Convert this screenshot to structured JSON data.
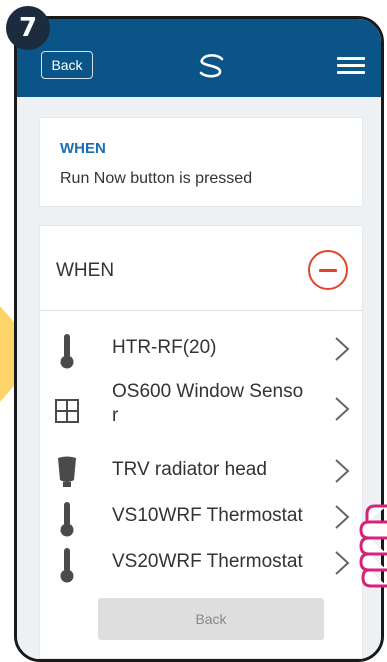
{
  "step": "7",
  "header": {
    "back_label": "Back",
    "logo_icon": "salus-logo-icon",
    "menu_icon": "hamburger-menu-icon"
  },
  "trigger_card": {
    "heading": "WHEN",
    "description": "Run Now button is pressed"
  },
  "when_card": {
    "title": "WHEN",
    "remove_icon": "remove-minus-icon",
    "devices": [
      {
        "label": "HTR-RF(20)",
        "icon": "thermometer-icon"
      },
      {
        "label": "OS600 Window Senso\nr",
        "icon": "window-icon"
      },
      {
        "label": "TRV radiator head",
        "icon": "trv-head-icon"
      },
      {
        "label": "VS10WRF Thermostat",
        "icon": "thermometer-icon"
      },
      {
        "label": "VS20WRF Thermostat",
        "icon": "thermometer-icon"
      }
    ],
    "back_label": "Back"
  },
  "colors": {
    "header": "#0b5488",
    "accent_blue": "#1a6fb4",
    "remove_red": "#e0452b",
    "hint_yellow": "#fcd46a",
    "hand_pink": "#d6237a"
  }
}
